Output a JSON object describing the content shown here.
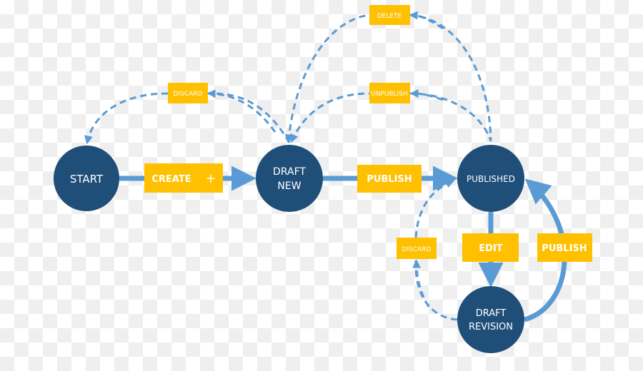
{
  "colors": {
    "node": "#1f4e79",
    "label": "#ffc000",
    "arrow": "#5b9bd5"
  },
  "nodes": {
    "start": "START",
    "draft_new_1": "DRAFT",
    "draft_new_2": "NEW",
    "published": "PUBLISHED",
    "draft_revision_1": "DRAFT",
    "draft_revision_2": "REVISION"
  },
  "transitions": {
    "create": "CREATE",
    "create_icon": "+",
    "publish": "PUBLISH",
    "discard_new": "DISCARD",
    "unpublish": "UNPUBLISH",
    "delete": "DELETE",
    "edit": "EDIT",
    "publish_revision": "PUBLISH",
    "discard_revision": "DISCARD"
  }
}
